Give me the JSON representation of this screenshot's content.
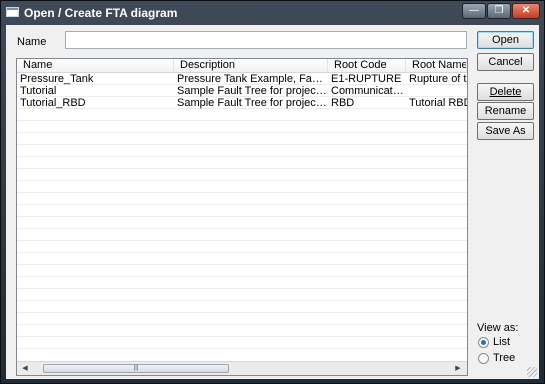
{
  "window": {
    "title": "Open / Create FTA diagram",
    "minimize_glyph": "—",
    "restore_glyph": "❐",
    "close_glyph": "✕"
  },
  "name_field": {
    "label": "Name",
    "value": ""
  },
  "list": {
    "columns": [
      "Name",
      "Description",
      "Root Code",
      "Root Name"
    ],
    "rows": [
      [
        "Pressure_Tank",
        "Pressure Tank Example, Fault Tree Ha...",
        "E1-RUPTURE",
        "Rupture of tank"
      ],
      [
        "Tutorial",
        "Sample Fault Tree for project TUTORIA...",
        "Communication sy...",
        ""
      ],
      [
        "Tutorial_RBD",
        "Sample Fault Tree for project TUTORIA...",
        "RBD",
        "Tutorial RBD St"
      ]
    ],
    "scroll_left_glyph": "◀",
    "scroll_right_glyph": "▶",
    "thumb_grip": "|||"
  },
  "buttons": {
    "open": "Open",
    "cancel": "Cancel",
    "delete": "Delete",
    "rename": "Rename",
    "save_as": "Save As"
  },
  "view_as": {
    "label": "View as:",
    "options": [
      "List",
      "Tree"
    ],
    "selected": "List"
  },
  "icons": [
    "app-window-icon",
    "minimize-icon",
    "restore-icon",
    "close-icon",
    "scroll-left-icon",
    "scroll-right-icon",
    "resize-grip-icon"
  ]
}
